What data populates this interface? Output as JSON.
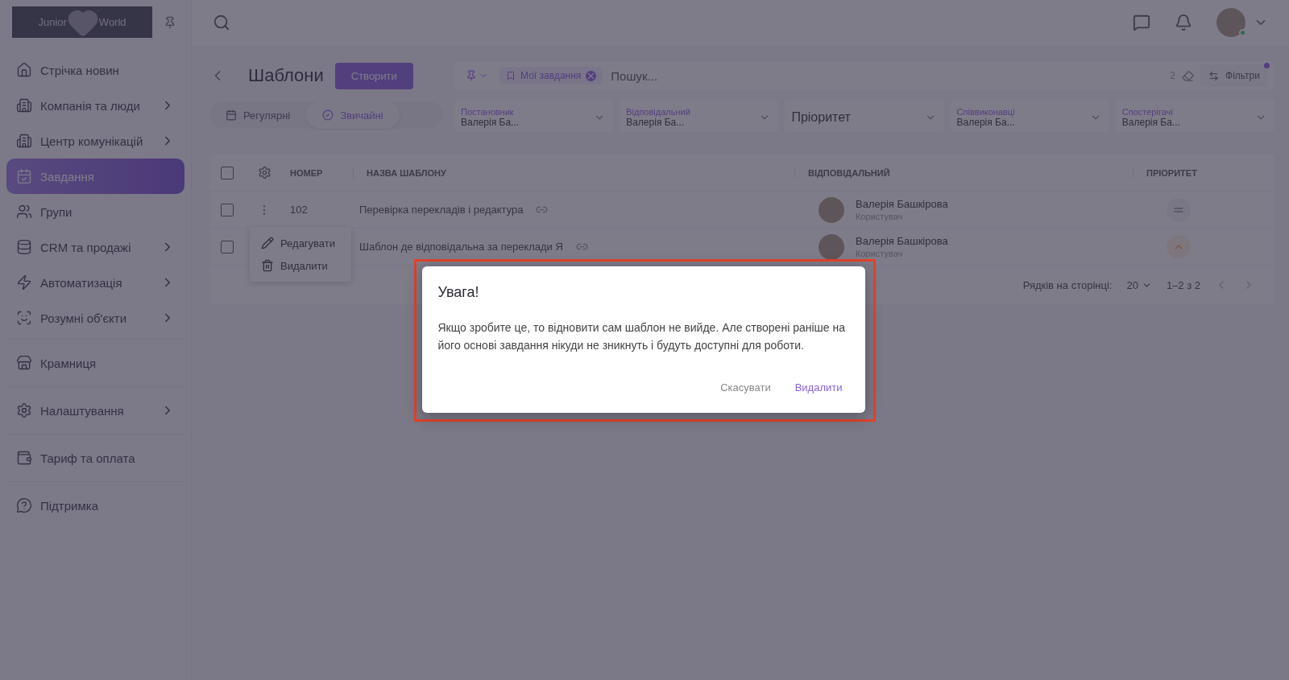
{
  "logo": {
    "left": "Junior",
    "right": "World"
  },
  "sidebar": {
    "sections": [
      {
        "items": [
          {
            "label": "Стрічка новин",
            "expandable": false,
            "selected": false
          },
          {
            "label": "Компанія та люди",
            "expandable": true,
            "selected": false
          },
          {
            "label": "Центр комунікацій",
            "expandable": true,
            "selected": false
          },
          {
            "label": "Завдання",
            "expandable": false,
            "selected": true
          },
          {
            "label": "Групи",
            "expandable": false,
            "selected": false
          },
          {
            "label": "CRM та продажі",
            "expandable": true,
            "selected": false
          },
          {
            "label": "Автоматизація",
            "expandable": true,
            "selected": false
          },
          {
            "label": "Розумні об'єкти",
            "expandable": true,
            "selected": false
          }
        ]
      },
      {
        "items": [
          {
            "label": "Крамниця",
            "expandable": false,
            "selected": false
          }
        ]
      },
      {
        "items": [
          {
            "label": "Налаштування",
            "expandable": true,
            "selected": false
          }
        ]
      },
      {
        "items": [
          {
            "label": "Тариф та оплата",
            "expandable": false,
            "selected": false
          }
        ]
      },
      {
        "items": [
          {
            "label": "Підтримка",
            "expandable": false,
            "selected": false
          }
        ]
      }
    ]
  },
  "page": {
    "title": "Шаблони",
    "create_button": "Створити"
  },
  "view_tabs": [
    {
      "label": "Регулярні",
      "selected": false
    },
    {
      "label": "Звичайні",
      "selected": true
    }
  ],
  "search": {
    "chip": "Мої завдання",
    "placeholder": "Пошук...",
    "count": "2",
    "filters_button": "Фільтри"
  },
  "filters": [
    {
      "label": "Постановник",
      "value": "Валерія Ба..."
    },
    {
      "label": "Відповідальний",
      "value": "Валерія Ба..."
    },
    {
      "placeholder": "Пріоритет"
    },
    {
      "label": "Співвиконавці",
      "value": "Валерія Ба..."
    },
    {
      "label": "Спостерігачі",
      "value": "Валерія Ба..."
    }
  ],
  "table": {
    "columns": [
      "НОМЕР",
      "НАЗВА ШАБЛОНУ",
      "ВІДПОВІДАЛЬНИЙ",
      "ПРІОРИТЕТ"
    ],
    "all_checked": false,
    "rows": [
      {
        "checked": false,
        "number": "102",
        "name": "Перевірка перекладів і редактура",
        "assignee": "Валерія Башкірова",
        "role": "Користувач",
        "kind": "medium"
      },
      {
        "checked": false,
        "name": "Шаблон де відповідальна за переклади Я",
        "assignee": "Валерія Башкірова",
        "role": "Користувач",
        "kind": "high"
      }
    ],
    "pagination": {
      "label": "Рядків на сторінці:",
      "per_page": "20",
      "range": "1–2 з 2"
    }
  },
  "context_menu": [
    {
      "label": "Редагувати",
      "kind": "edit"
    },
    {
      "label": "Видалити",
      "kind": "delete"
    }
  ],
  "dialog": {
    "title": "Увага!",
    "message": "Якщо зробите це, то відновити сам шаблон не вийде. Але створені раніше на його основі завдання нікуди не зникнуть і будуть доступні для роботи.",
    "buttons": [
      {
        "label": "Скасувати",
        "kind": "secondary"
      },
      {
        "label": "Видалити",
        "kind": "primary"
      }
    ]
  }
}
